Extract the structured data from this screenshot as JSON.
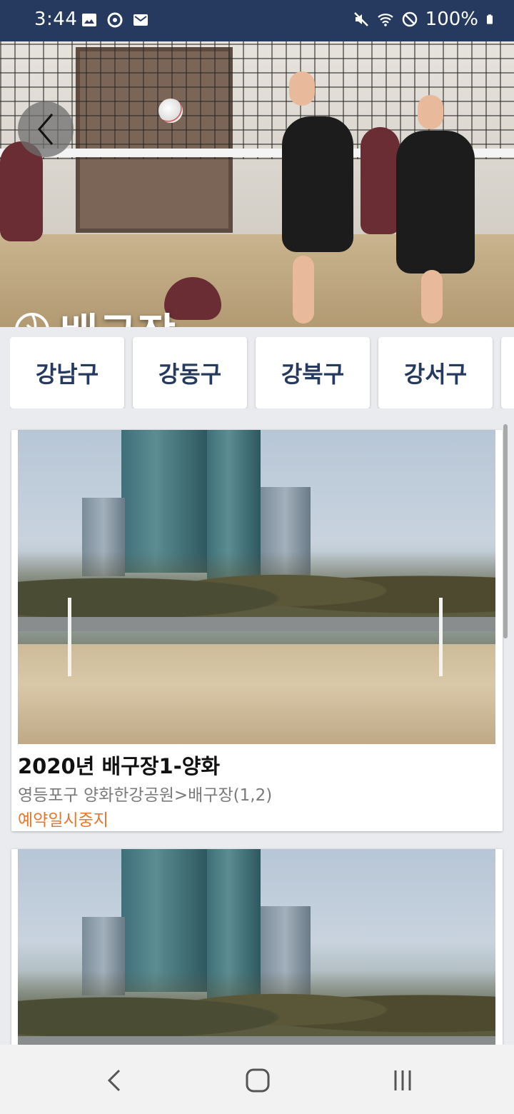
{
  "status_bar": {
    "time": "3:44",
    "battery": "100%",
    "left_icons": [
      "image-icon",
      "sync-icon",
      "mail-icon"
    ],
    "right_icons": [
      "mute-icon",
      "wifi-icon",
      "block-icon",
      "battery-icon"
    ]
  },
  "hero": {
    "title": "배구장",
    "icon": "volleyball-icon"
  },
  "districts": [
    {
      "label": "강남구"
    },
    {
      "label": "강동구"
    },
    {
      "label": "강북구"
    },
    {
      "label": "강서구"
    }
  ],
  "facilities": [
    {
      "name": "2020년 배구장1-양화",
      "address": "영등포구 양화한강공원>배구장(1,2)",
      "status": "예약일시중지"
    },
    {
      "name": "",
      "address": "",
      "status": ""
    }
  ],
  "colors": {
    "status_bar": "#253a5e",
    "district_text": "#253a5e",
    "status_text": "#e8772b",
    "background": "#e9ebee"
  }
}
